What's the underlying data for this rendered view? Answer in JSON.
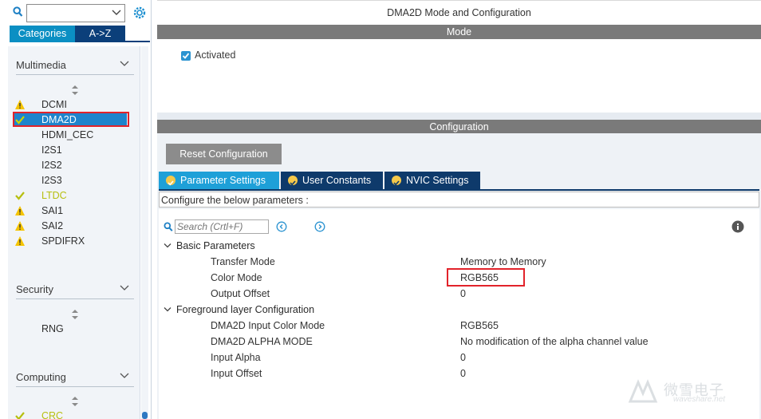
{
  "left": {
    "search_value": "",
    "tabs": [
      "Categories",
      "A->Z"
    ],
    "sections": [
      {
        "title": "Multimedia",
        "items": [
          {
            "label": "DCMI",
            "status": "warning"
          },
          {
            "label": "DMA2D",
            "status": "ok",
            "selected": true
          },
          {
            "label": "HDMI_CEC",
            "status": "none"
          },
          {
            "label": "I2S1",
            "status": "none"
          },
          {
            "label": "I2S2",
            "status": "none"
          },
          {
            "label": "I2S3",
            "status": "none"
          },
          {
            "label": "LTDC",
            "status": "ok"
          },
          {
            "label": "SAI1",
            "status": "warning"
          },
          {
            "label": "SAI2",
            "status": "warning"
          },
          {
            "label": "SPDIFRX",
            "status": "warning"
          }
        ]
      },
      {
        "title": "Security",
        "items": [
          {
            "label": "RNG",
            "status": "none"
          }
        ]
      },
      {
        "title": "Computing",
        "items": [
          {
            "label": "CRC",
            "status": "ok"
          }
        ]
      }
    ]
  },
  "right": {
    "title": "DMA2D Mode and Configuration",
    "mode_header": "Mode",
    "activated_label": "Activated",
    "activated": true,
    "config_header": "Configuration",
    "reset_button": "Reset Configuration",
    "tabs": [
      "Parameter Settings",
      "User Constants",
      "NVIC Settings"
    ],
    "configure_label": "Configure the below parameters :",
    "search_placeholder": "Search (Crtl+F)",
    "groups": [
      {
        "title": "Basic Parameters",
        "rows": [
          {
            "name": "Transfer Mode",
            "value": "Memory to Memory"
          },
          {
            "name": "Color Mode",
            "value": "RGB565"
          },
          {
            "name": "Output Offset",
            "value": "0"
          }
        ]
      },
      {
        "title": "Foreground layer Configuration",
        "rows": [
          {
            "name": "DMA2D Input Color Mode",
            "value": "RGB565"
          },
          {
            "name": "DMA2D ALPHA MODE",
            "value": "No modification of the alpha channel value"
          },
          {
            "name": "Input Alpha",
            "value": "0"
          },
          {
            "name": "Input Offset",
            "value": "0"
          }
        ]
      }
    ]
  },
  "watermark": {
    "text": "微雪电子",
    "sub": "waveshare.net"
  },
  "colors": {
    "accent": "#1ea0d8",
    "dark_tab": "#0e3a6b",
    "highlight_box": "#e2232a",
    "warning": "#f5c400",
    "ok": "#b7bf10"
  }
}
